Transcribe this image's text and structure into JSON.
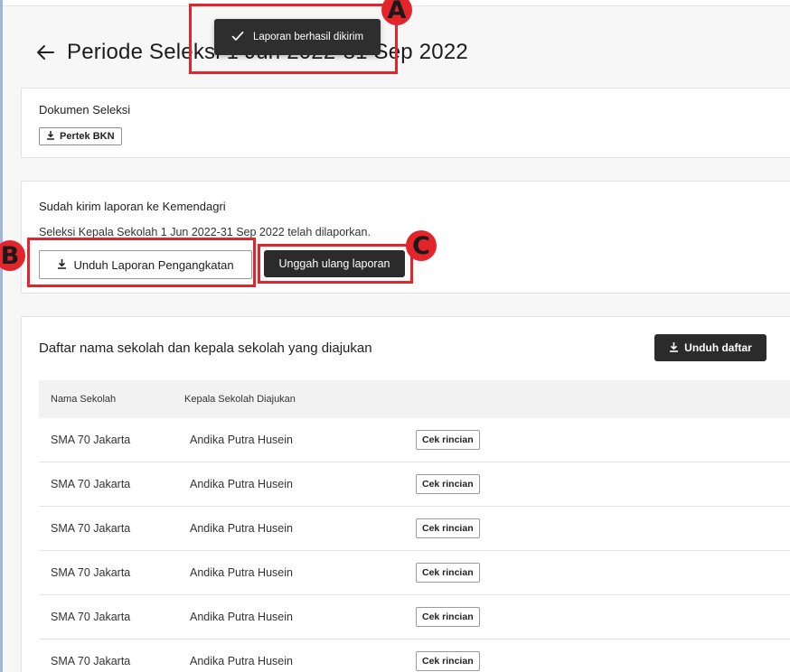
{
  "page": {
    "title": "Periode Seleksi 1 Jun 2022-31 Sep 2022"
  },
  "toast": {
    "message": "Laporan berhasil dikirim",
    "icon": "check-icon"
  },
  "documents": {
    "title": "Dokumen Seleksi",
    "button_label": "Pertek BKN",
    "button_icon": "download-icon"
  },
  "report": {
    "title": "Sudah kirim laporan ke Kemendagri",
    "description": "Seleksi Kepala Sekolah 1 Jun 2022-31 Sep 2022 telah dilaporkan.",
    "download_label": "Unduh Laporan Pengangkatan",
    "reupload_label": "Unggah ulang laporan"
  },
  "list": {
    "title": "Daftar nama sekolah dan kepala sekolah yang diajukan",
    "download_label": "Unduh daftar",
    "columns": [
      "Nama Sekolah",
      "Kepala Sekolah Diajukan"
    ],
    "detail_label": "Cek rincian",
    "rows": [
      {
        "school": "SMA 70 Jakarta",
        "head": "Andika Putra Husein"
      },
      {
        "school": "SMA 70 Jakarta",
        "head": "Andika Putra Husein"
      },
      {
        "school": "SMA 70 Jakarta",
        "head": "Andika Putra Husein"
      },
      {
        "school": "SMA 70 Jakarta",
        "head": "Andika Putra Husein"
      },
      {
        "school": "SMA 70 Jakarta",
        "head": "Andika Putra Husein"
      },
      {
        "school": "SMA 70 Jakarta",
        "head": "Andika Putra Husein"
      }
    ]
  },
  "annotations": [
    "A",
    "B",
    "C"
  ],
  "colors": {
    "annotation": "#e3242b",
    "dark_button": "#2b2b2b",
    "toast_bg": "#2e2e2e"
  }
}
